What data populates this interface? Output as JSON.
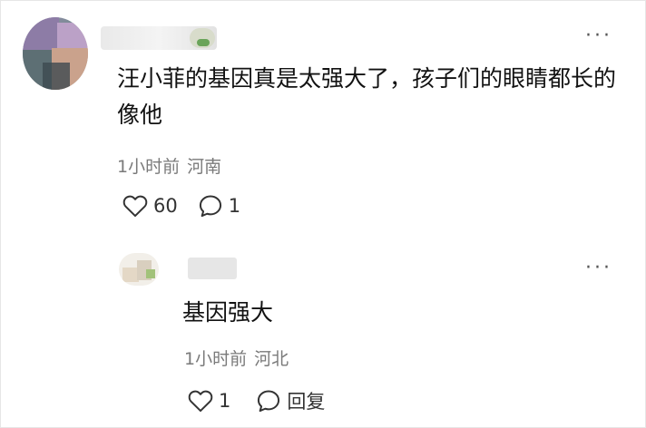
{
  "comment": {
    "text": "汪小菲的基因真是太强大了，孩子们的眼睛都长的像他",
    "time": "1小时前",
    "location": "河南",
    "like_count": "60",
    "reply_count": "1",
    "icons": {
      "like": "heart-icon",
      "comment": "comment-bubble-icon",
      "more": "more-dots-icon"
    }
  },
  "reply": {
    "text": "基因强大",
    "time": "1小时前",
    "location": "河北",
    "like_count": "1",
    "reply_label": "回复",
    "icons": {
      "like": "heart-icon",
      "comment": "comment-bubble-icon",
      "more": "more-dots-icon"
    }
  },
  "more_label": "···",
  "colors": {
    "text": "#121212",
    "meta": "#7a7a7a",
    "icon": "#333333",
    "background": "#ffffff"
  }
}
